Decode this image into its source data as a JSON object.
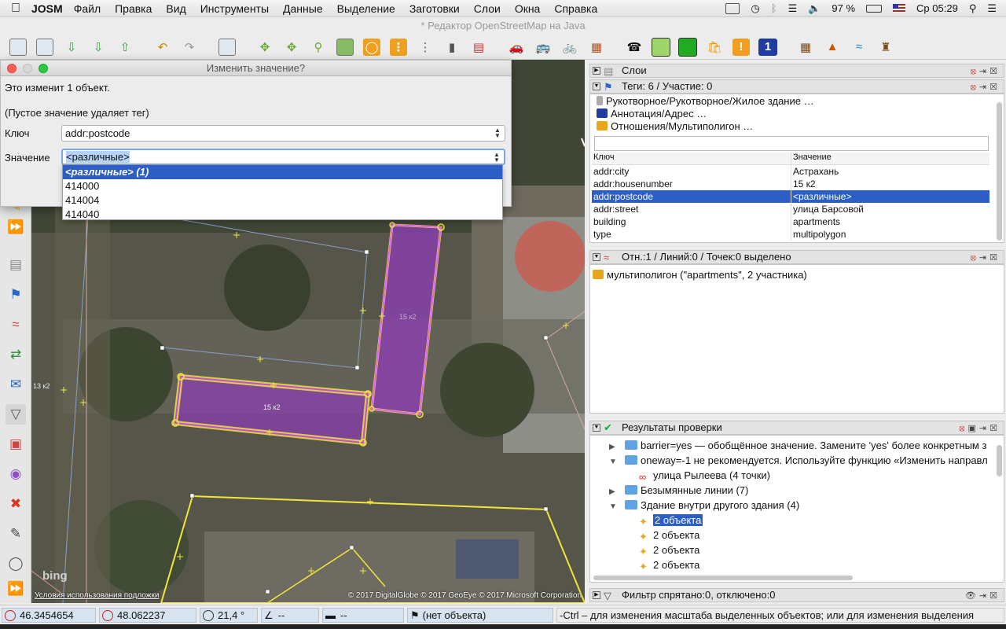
{
  "menubar": {
    "app_name": "JOSM",
    "items": [
      "Файл",
      "Правка",
      "Вид",
      "Инструменты",
      "Данные",
      "Выделение",
      "Заготовки",
      "Слои",
      "Окна",
      "Справка"
    ],
    "battery": "97 %",
    "clock": "Ср 05:29"
  },
  "window_title": "* Редактор OpenStreetMap на Java",
  "dialog": {
    "title": "Изменить значение?",
    "info_text": "Это изменит 1 объект.",
    "hint_text": "(Пустое значение удаляет тег)",
    "key_label": "Ключ",
    "key_value": "addr:postcode",
    "value_label": "Значение",
    "value_value": "<различные>",
    "options": [
      "<различные> (1)",
      "414000",
      "414004",
      "414040"
    ]
  },
  "map": {
    "label_building_1": "15 к2",
    "label_building_2": "15 к2",
    "label_left": "13 к2",
    "bing": "bing",
    "terms": "Условия использования подложки",
    "copyright": "© 2017 DigitalGlobe © 2017 GeoEye © 2017 Microsoft Corporation"
  },
  "layers_panel": {
    "title": "Слои"
  },
  "tags_panel": {
    "title": "Теги: 6 / Участие: 0",
    "presets": [
      "Рукотворное/Рукотворное/Жилое здание …",
      "Аннотация/Адрес …",
      "Отношения/Мультиполигон …"
    ],
    "col_key": "Ключ",
    "col_value": "Значение",
    "rows": [
      {
        "key": "addr:city",
        "value": "Астрахань"
      },
      {
        "key": "addr:housenumber",
        "value": "15 к2"
      },
      {
        "key": "addr:postcode",
        "value": "<различные>"
      },
      {
        "key": "addr:street",
        "value": "улица Барсовой"
      },
      {
        "key": "building",
        "value": "apartments"
      },
      {
        "key": "type",
        "value": "multipolygon"
      }
    ]
  },
  "selection_panel": {
    "title": "Отн.:1 / Линий:0 / Точек:0 выделено",
    "item": "мультиполигон (\"apartments\", 2 участника)"
  },
  "validation_panel": {
    "title": "Результаты проверки",
    "rows": [
      "barrier=yes — обобщённое значение. Замените 'yes' более конкретным з",
      "oneway=-1 не рекомендуется. Используйте функцию «Изменить направл",
      "улица Рылеева (4 точки)",
      "Безымянные линии (7)",
      "Здание внутри другого здания (4)",
      "2 объекта",
      "2 объекта",
      "2 объекта",
      "2 объекта"
    ]
  },
  "filter_panel": {
    "title": "Фильтр спрятано:0, отключено:0"
  },
  "statusbar": {
    "lat": "46.3454654",
    "lon": "48.062237",
    "heading": "21,4 °",
    "angle": "--",
    "length": "--",
    "object": "(нет объекта)",
    "help": "-Ctrl – для изменения масштаба выделенных объектов; или для изменения выделения"
  }
}
